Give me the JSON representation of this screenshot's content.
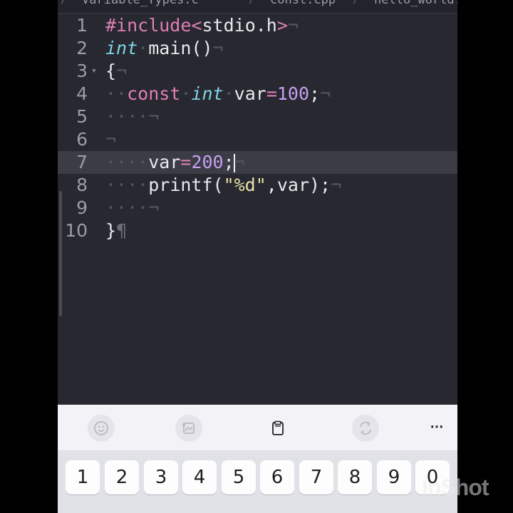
{
  "tabs": [
    {
      "label": "Variable_Types.c"
    },
    {
      "label": "const.cpp"
    },
    {
      "label": "hello_world.cpp"
    }
  ],
  "editor": {
    "current_line": 7,
    "lines": [
      {
        "number": "1",
        "text": "#include<stdio.h>¬"
      },
      {
        "number": "2",
        "text": "int·main()¬"
      },
      {
        "number": "3",
        "text": "{¬"
      },
      {
        "number": "4",
        "text": "··const·int·var=100;¬"
      },
      {
        "number": "5",
        "text": "····¬"
      },
      {
        "number": "6",
        "text": "¬"
      },
      {
        "number": "7",
        "text": "····var=200;¬"
      },
      {
        "number": "8",
        "text": "····printf(\"%d\",var);¬"
      },
      {
        "number": "9",
        "text": "····¬"
      },
      {
        "number": "10",
        "text": "}¶"
      }
    ]
  },
  "toolbar": {
    "items": [
      {
        "icon": "emoji-icon"
      },
      {
        "icon": "image-convert-icon"
      },
      {
        "icon": "clipboard-icon"
      },
      {
        "icon": "translate-icon"
      },
      {
        "icon": "more-icon",
        "label": "···"
      }
    ]
  },
  "keyboard": {
    "number_row": [
      "1",
      "2",
      "3",
      "4",
      "5",
      "6",
      "7",
      "8",
      "9",
      "0"
    ]
  },
  "watermark": {
    "text": "InShot"
  },
  "colors": {
    "editor_bg": "#272830",
    "keyword": "#e07fb6",
    "type": "#7fd3e6",
    "number": "#c6a0f0",
    "string": "#e7e2a8",
    "current_line_bg": "#3b3c45"
  }
}
